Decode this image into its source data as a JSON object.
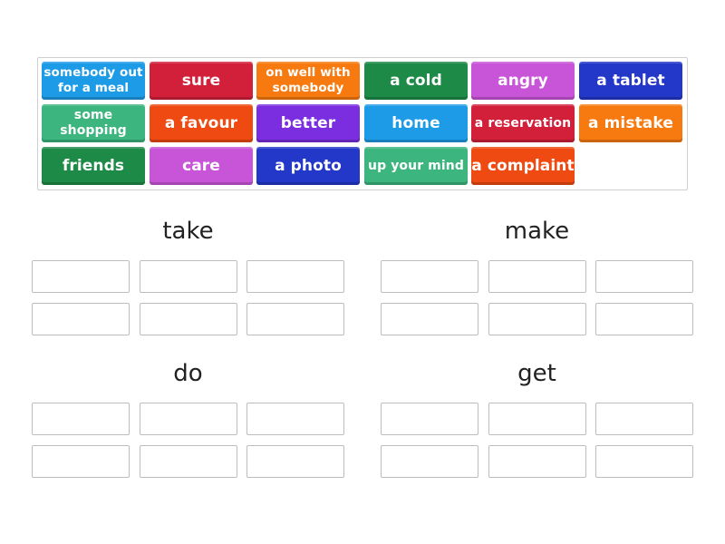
{
  "tiles": [
    {
      "label": "somebody out for a meal",
      "color": "#1e9be6"
    },
    {
      "label": "sure",
      "color": "#d2203a"
    },
    {
      "label": "on well with somebody",
      "color": "#f77a10"
    },
    {
      "label": "a cold",
      "color": "#1e8a48"
    },
    {
      "label": "angry",
      "color": "#c855d8"
    },
    {
      "label": "a tablet",
      "color": "#2338c8"
    },
    {
      "label": "some shopping",
      "color": "#3cb57e"
    },
    {
      "label": "a favour",
      "color": "#ee4a12"
    },
    {
      "label": "better",
      "color": "#7a2ee0"
    },
    {
      "label": "home",
      "color": "#1e9be6"
    },
    {
      "label": "a reservation",
      "color": "#d2203a"
    },
    {
      "label": "a mistake",
      "color": "#f77a10"
    },
    {
      "label": "friends",
      "color": "#1e8a48"
    },
    {
      "label": "care",
      "color": "#c855d8"
    },
    {
      "label": "a photo",
      "color": "#2338c8"
    },
    {
      "label": "up your mind",
      "color": "#3cb57e"
    },
    {
      "label": "a complaint",
      "color": "#ee4a12"
    }
  ],
  "groups": [
    {
      "title": "take",
      "slots": 6
    },
    {
      "title": "make",
      "slots": 6
    },
    {
      "title": "do",
      "slots": 6
    },
    {
      "title": "get",
      "slots": 6
    }
  ]
}
